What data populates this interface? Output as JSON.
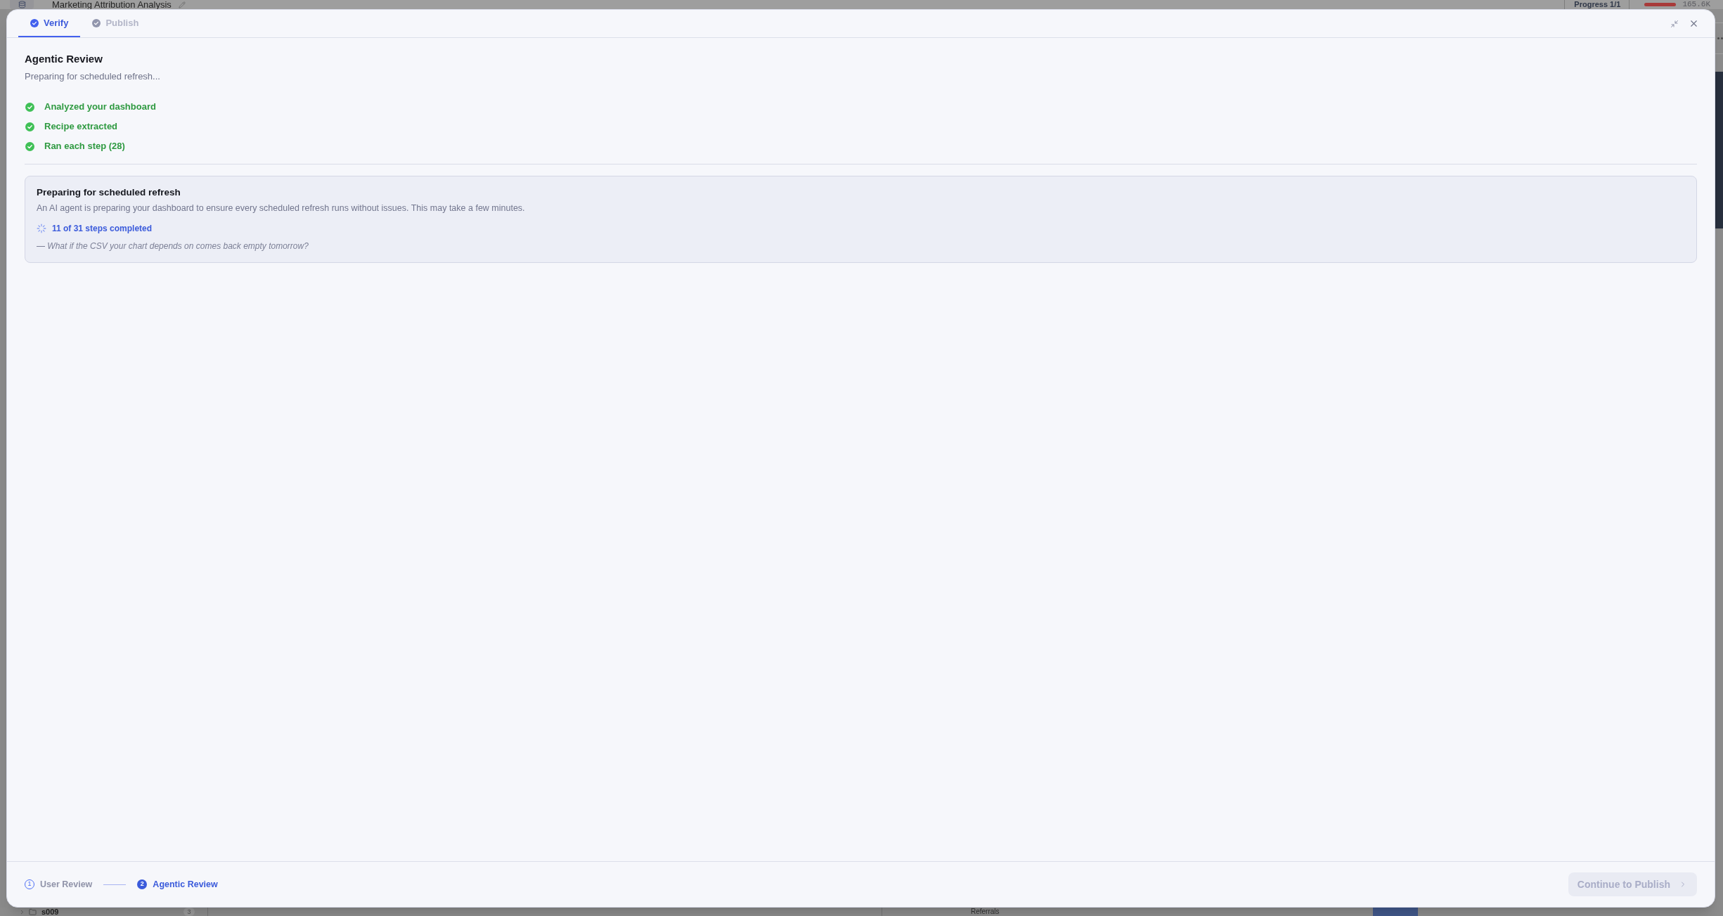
{
  "background": {
    "title": "Marketing Attribution Analysis",
    "progress_label": "Progress 1/1",
    "value": "165.6K",
    "tree_row": {
      "label": "s009",
      "count": "3"
    },
    "chart_label": "Referrals"
  },
  "dialog": {
    "tabs": [
      {
        "label": "Verify",
        "selected": true
      },
      {
        "label": "Publish",
        "selected": false
      }
    ],
    "title": "Agentic Review",
    "subtitle": "Preparing for scheduled refresh...",
    "checklist": [
      {
        "label": "Analyzed your dashboard",
        "done": true
      },
      {
        "label": "Recipe extracted",
        "done": true
      },
      {
        "label": "Ran each step (28)",
        "done": true
      }
    ],
    "status_card": {
      "title": "Preparing for scheduled refresh",
      "description": "An AI agent is preparing your dashboard to ensure every scheduled refresh runs without issues. This may take a few minutes.",
      "progress_text": "11 of 31 steps completed",
      "quote": "— What if the CSV your chart depends on comes back empty tomorrow?"
    },
    "stepper": [
      {
        "number": "1",
        "label": "User Review",
        "current": false
      },
      {
        "number": "2",
        "label": "Agentic Review",
        "current": true
      }
    ],
    "continue_button": {
      "label": "Continue to Publish",
      "disabled": true
    }
  }
}
